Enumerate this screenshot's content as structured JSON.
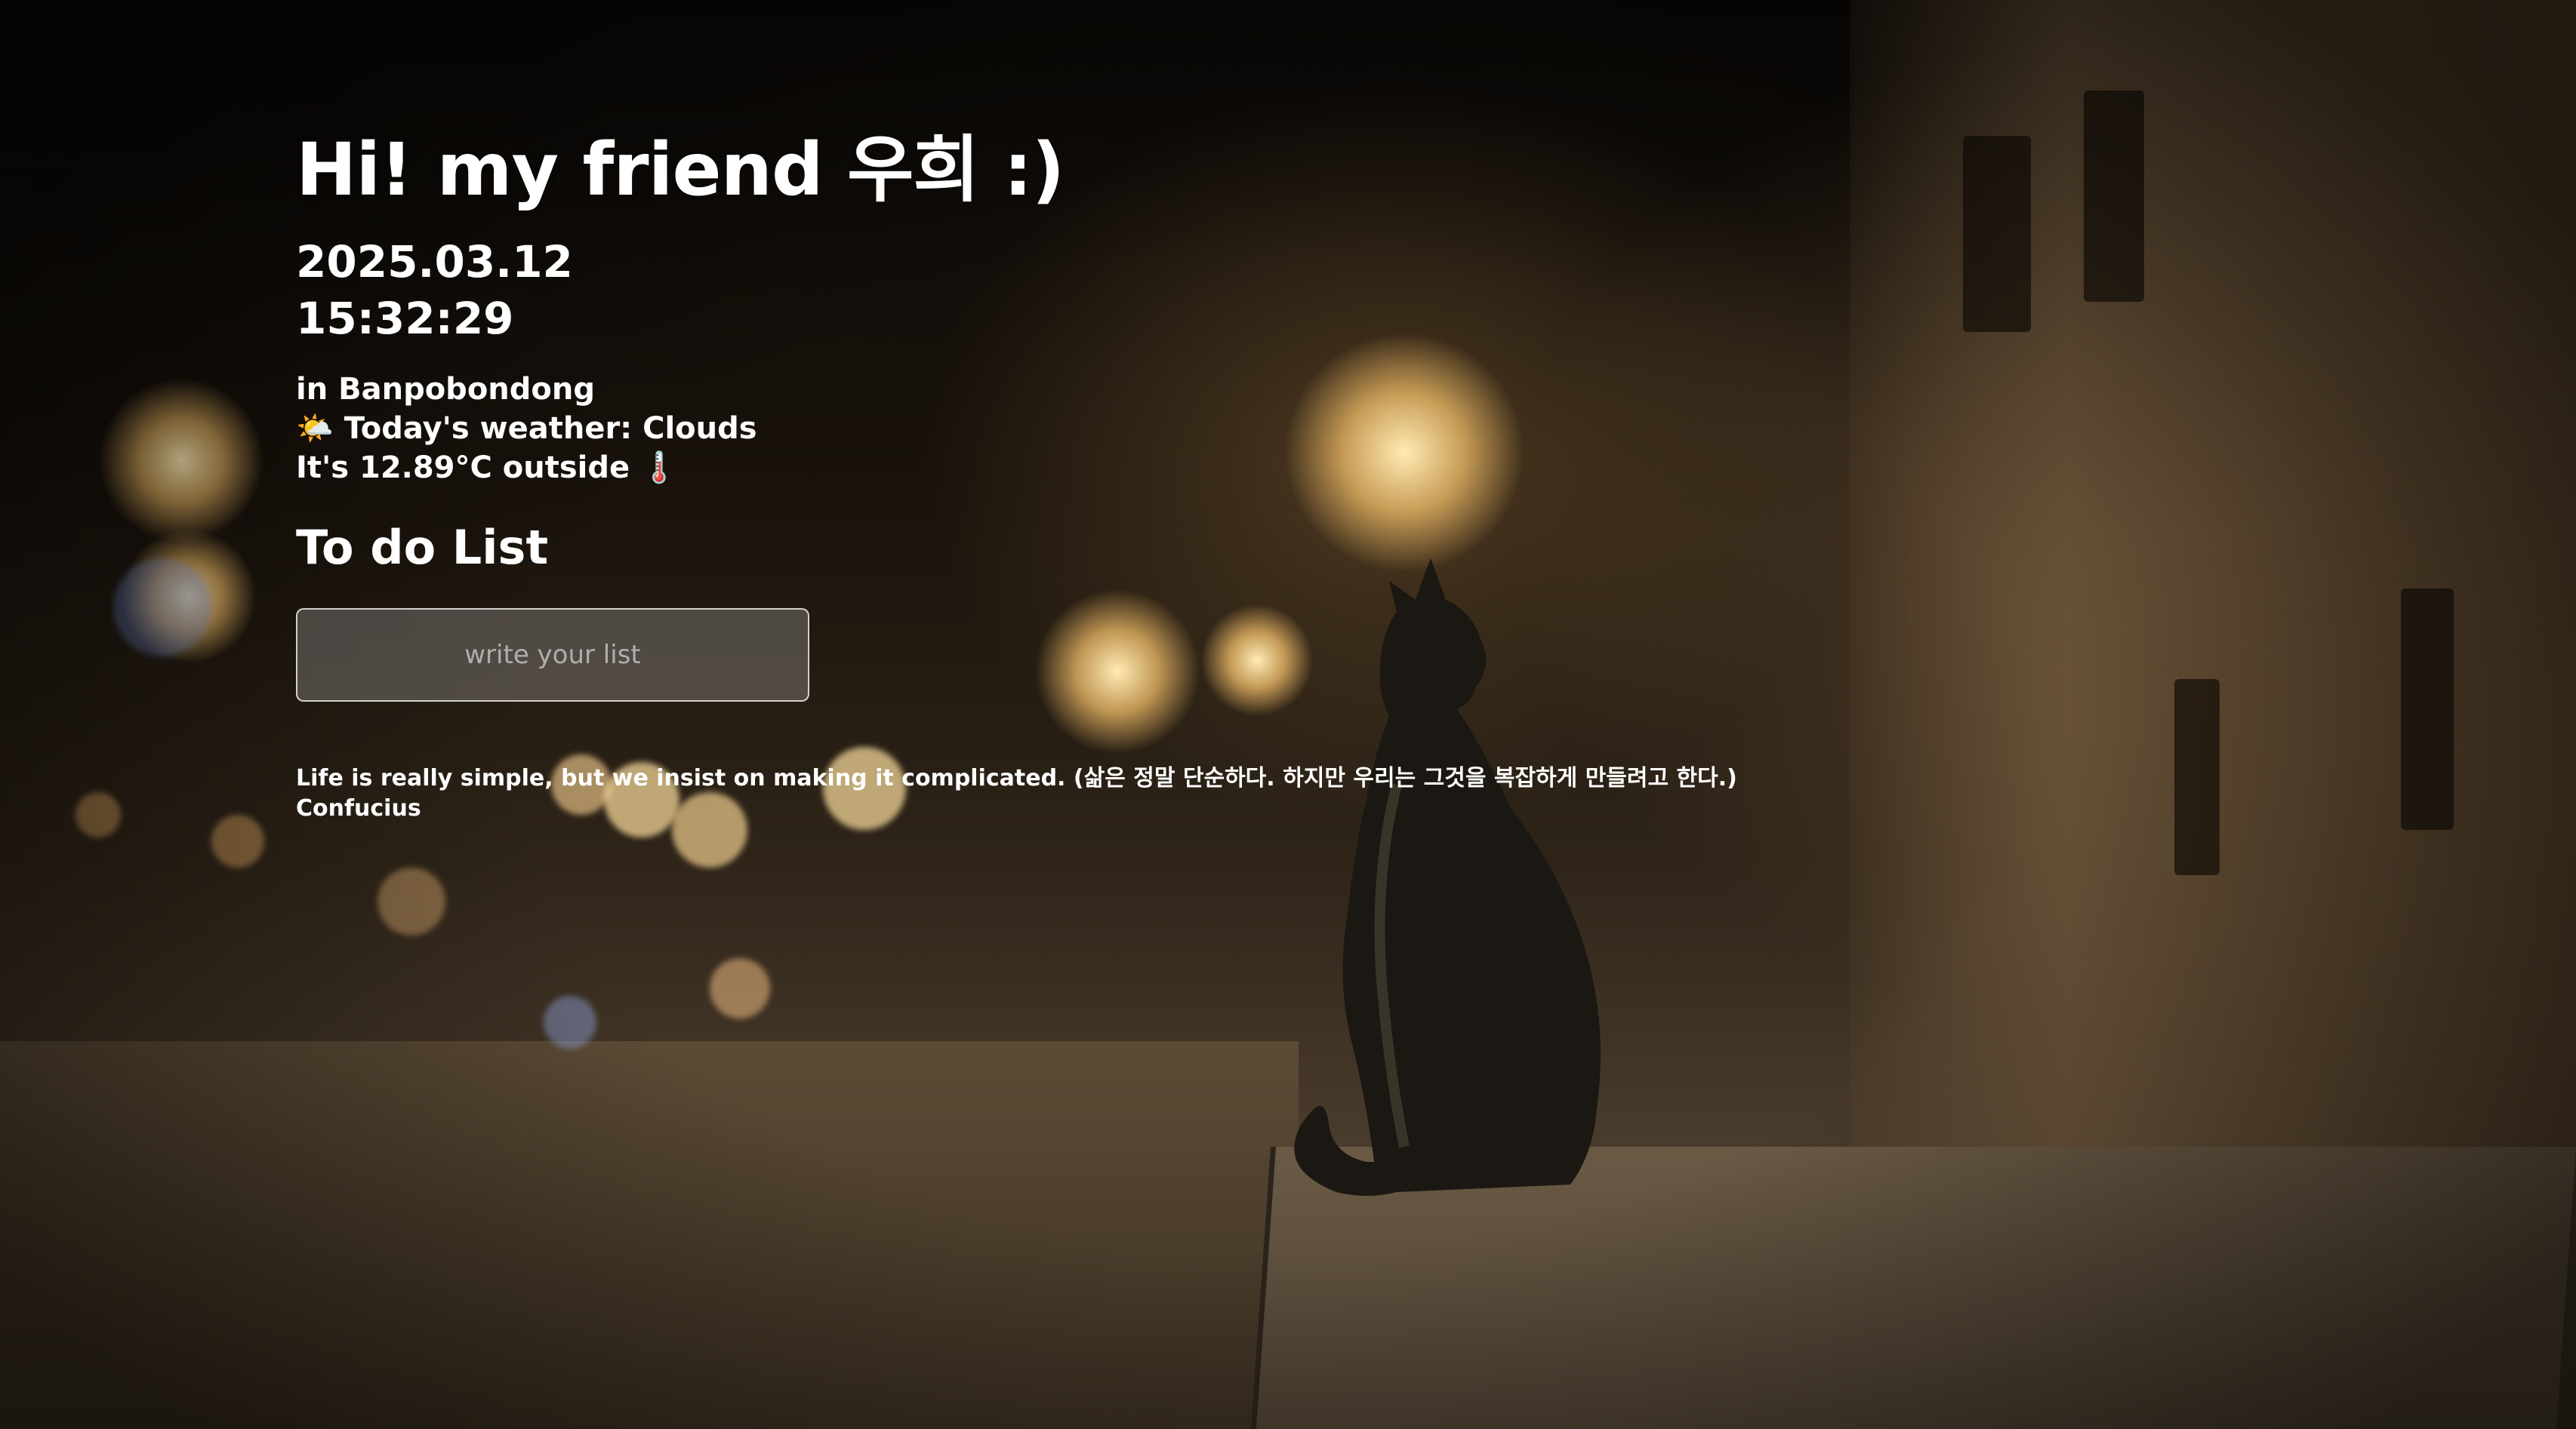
{
  "greeting": {
    "prefix": "Hi! my friend ",
    "name": "우희",
    "suffix": " :)"
  },
  "clock": {
    "date": "2025.03.12",
    "time": "15:32:29"
  },
  "weather": {
    "location_text": "in Banpobondong",
    "weather_icon": "sun-behind-cloud-icon",
    "weather_icon_glyph": "🌤️",
    "weather_text": "Today's weather: Clouds",
    "temp_text": "It's 12.89°C outside",
    "temp_icon": "thermometer-icon",
    "temp_icon_glyph": "🌡️"
  },
  "todo": {
    "title": "To do List",
    "placeholder": "write your list",
    "items": []
  },
  "quote": {
    "text": "Life is really simple, but we insist on making it complicated. (삶은 정말 단순하다. 하지만 우리는 그것을 복잡하게 만들려고 한다.)",
    "author": "Confucius"
  },
  "background": {
    "image_subject": "black cat sitting on a night street"
  }
}
